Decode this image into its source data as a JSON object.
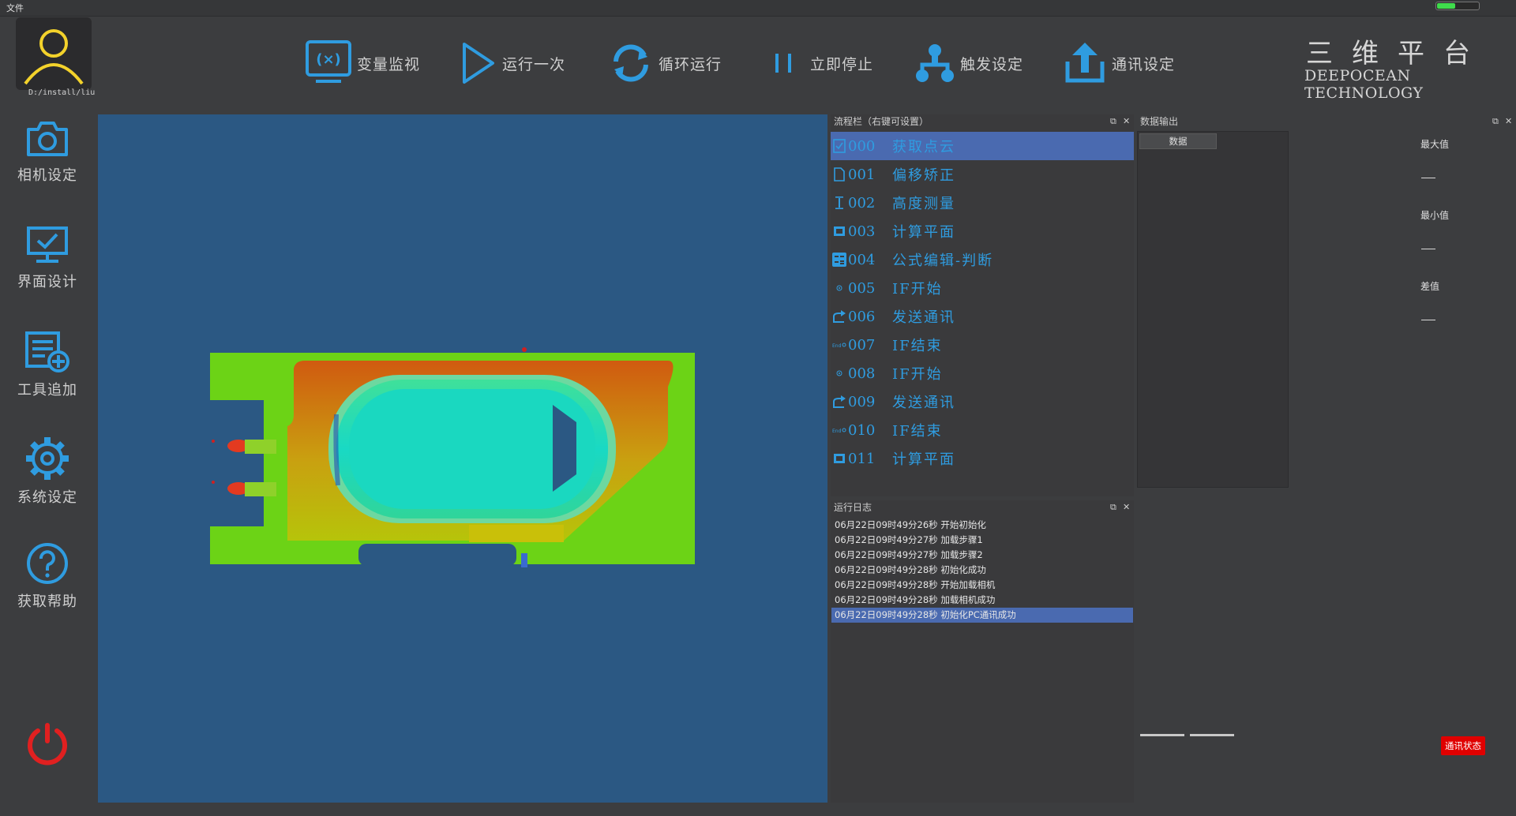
{
  "menu": {
    "file": "文件"
  },
  "status": {
    "battery_level": 0.45,
    "battery_color": "#3fdc4c"
  },
  "user": {
    "path": "D:/install/liu"
  },
  "toolbar": [
    {
      "label": "变量监视",
      "icon": "variable-monitor-icon"
    },
    {
      "label": "运行一次",
      "icon": "play-icon"
    },
    {
      "label": "循环运行",
      "icon": "loop-icon"
    },
    {
      "label": "立即停止",
      "icon": "pause-icon"
    },
    {
      "label": "触发设定",
      "icon": "trigger-network-icon"
    },
    {
      "label": "通讯设定",
      "icon": "upload-icon"
    }
  ],
  "brand": {
    "cn": "三维平台",
    "en": "DEEPOCEAN TECHNOLOGY"
  },
  "sidebar": [
    {
      "label": "相机设定",
      "icon": "camera-icon"
    },
    {
      "label": "界面设计",
      "icon": "monitor-check-icon"
    },
    {
      "label": "工具追加",
      "icon": "list-add-icon"
    },
    {
      "label": "系统设定",
      "icon": "gear-icon"
    },
    {
      "label": "获取帮助",
      "icon": "help-icon"
    }
  ],
  "power": {
    "icon": "power-icon",
    "color": "#e02020"
  },
  "flow_panel": {
    "title": "流程栏（右键可设置）",
    "items": [
      {
        "num": "000",
        "name": "获取点云",
        "icon": "point-cloud-icon",
        "selected": true
      },
      {
        "num": "001",
        "name": "偏移矫正",
        "icon": "document-icon"
      },
      {
        "num": "002",
        "name": "高度测量",
        "icon": "height-icon"
      },
      {
        "num": "003",
        "name": "计算平面",
        "icon": "plane-icon"
      },
      {
        "num": "004",
        "name": "公式编辑-判断",
        "icon": "formula-icon"
      },
      {
        "num": "005",
        "name": "IF开始",
        "icon": "if-start-icon"
      },
      {
        "num": "006",
        "name": "发送通讯",
        "icon": "send-icon"
      },
      {
        "num": "007",
        "name": "IF结束",
        "icon": "if-end-icon"
      },
      {
        "num": "008",
        "name": "IF开始",
        "icon": "if-start-icon"
      },
      {
        "num": "009",
        "name": "发送通讯",
        "icon": "send-icon"
      },
      {
        "num": "010",
        "name": "IF结束",
        "icon": "if-end-icon"
      },
      {
        "num": "011",
        "name": "计算平面",
        "icon": "plane-icon"
      }
    ]
  },
  "log_panel": {
    "title": "运行日志",
    "lines": [
      "06月22日09时49分26秒 开始初始化",
      "06月22日09时49分27秒 加载步骤1",
      "06月22日09时49分27秒 加载步骤2",
      "06月22日09时49分28秒 初始化成功",
      "06月22日09时49分28秒 开始加载相机",
      "06月22日09时49分28秒 加载相机成功",
      "06月22日09时49分28秒 初始化PC通讯成功"
    ],
    "selected_index": 6
  },
  "data_panel": {
    "title": "数据输出",
    "column": "数据",
    "max_label": "最大值",
    "min_label": "最小值",
    "diff_label": "差值"
  },
  "comm_status": {
    "label": "通讯状态",
    "color": "#e00000"
  },
  "colors": {
    "accent": "#2f9ce0",
    "selected_row": "#4a6ab0",
    "viewer_bg": "#2b5883"
  }
}
